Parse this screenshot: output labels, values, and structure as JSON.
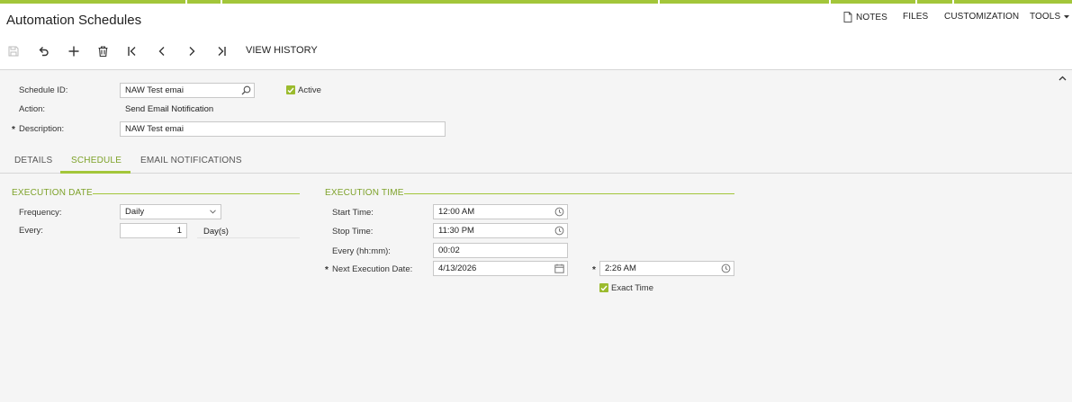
{
  "page": {
    "title": "Automation Schedules"
  },
  "topnav": {
    "notes": "NOTES",
    "files": "FILES",
    "customization": "CUSTOMIZATION",
    "tools": "TOOLS"
  },
  "toolbar": {
    "view_history": "VIEW HISTORY"
  },
  "form": {
    "schedule_id": {
      "label": "Schedule ID:",
      "value": "NAW Test emai"
    },
    "active": {
      "label": "Active",
      "checked": true
    },
    "action": {
      "label": "Action:",
      "value": "Send Email Notification"
    },
    "description": {
      "label": "Description:",
      "value": "NAW Test emai",
      "required": "*"
    }
  },
  "tabs": [
    {
      "label": "DETAILS"
    },
    {
      "label": "SCHEDULE",
      "active": true
    },
    {
      "label": "EMAIL NOTIFICATIONS"
    }
  ],
  "execution_date": {
    "title": "EXECUTION DATE",
    "frequency": {
      "label": "Frequency:",
      "value": "Daily"
    },
    "every": {
      "label": "Every:",
      "value": "1",
      "unit": "Day(s)"
    }
  },
  "execution_time": {
    "title": "EXECUTION TIME",
    "start_time": {
      "label": "Start Time:",
      "value": "12:00 AM"
    },
    "stop_time": {
      "label": "Stop Time:",
      "value": "11:30 PM"
    },
    "every_hhmm": {
      "label": "Every (hh:mm):",
      "value": "00:02"
    },
    "next_execution_date": {
      "label": "Next Execution Date:",
      "value": "4/13/2026",
      "required": "*"
    },
    "next_execution_time": {
      "value": "2:26 AM",
      "required": "*"
    },
    "exact_time": {
      "label": "Exact Time",
      "checked": true
    }
  },
  "colors": {
    "accent": "#a3c63a",
    "accent_text": "#7ea22a",
    "checkbox": "#9bbb2e"
  }
}
